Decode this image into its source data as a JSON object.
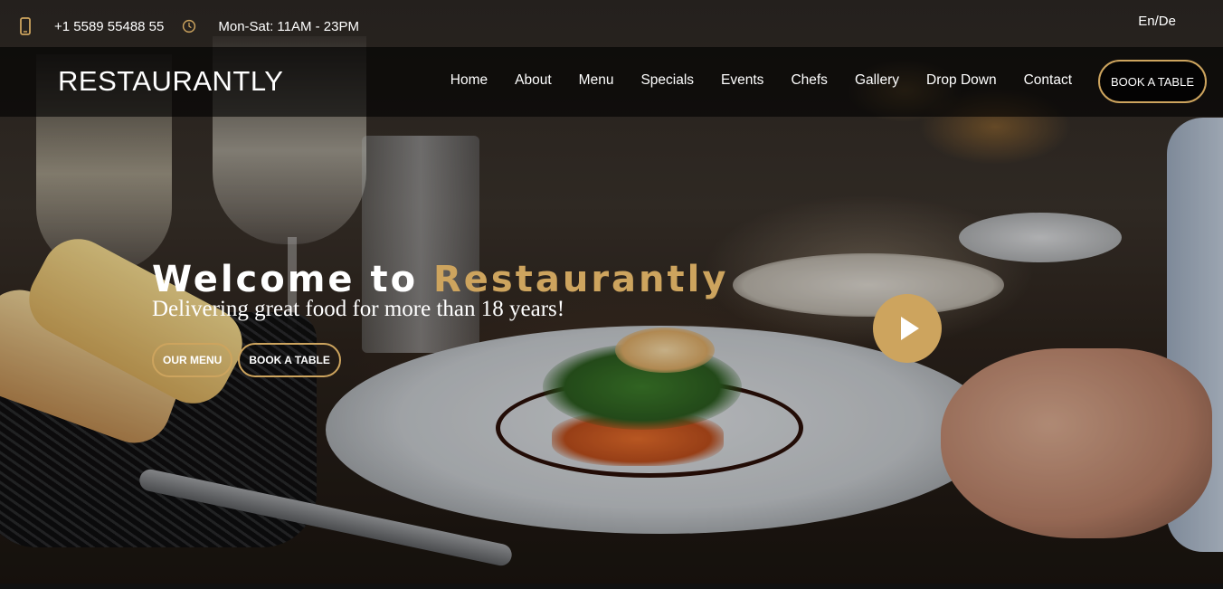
{
  "topbar": {
    "phone": "+1 5589 55488 55",
    "hours": "Mon-Sat: 11AM - 23PM",
    "language": "En/De",
    "icons": {
      "phone": "phone-icon",
      "clock": "clock-icon"
    }
  },
  "nav": {
    "logo": "RESTAURANTLY",
    "items": [
      {
        "label": "Home"
      },
      {
        "label": "About"
      },
      {
        "label": "Menu"
      },
      {
        "label": "Specials"
      },
      {
        "label": "Events"
      },
      {
        "label": "Chefs"
      },
      {
        "label": "Gallery"
      },
      {
        "label": "Drop Down"
      },
      {
        "label": "Contact"
      }
    ],
    "cta": "BOOK A TABLE"
  },
  "hero": {
    "welcome": "Welcome to",
    "brand": "Restaurantly",
    "tagline": "Delivering great food for more than 18 years!",
    "buttons": {
      "menu": "OUR MENU",
      "book": "BOOK A TABLE"
    },
    "play_icon": "play-icon"
  },
  "colors": {
    "accent": "#cda45e",
    "nav_bg": "rgba(0,0,0,0.62)",
    "text": "#ffffff"
  }
}
